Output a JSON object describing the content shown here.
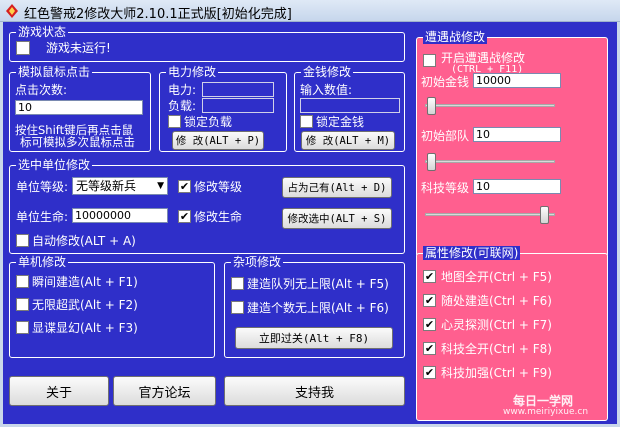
{
  "window": {
    "title": "红色警戒2修改大师2.10.1正式版[初始化完成]"
  },
  "game_status": {
    "title": "游戏状态",
    "status_text": "游戏未运行!"
  },
  "mouse": {
    "title": "模拟鼠标点击",
    "clicks_label": "点击次数:",
    "clicks_value": "10",
    "hint_line1": "按住Shift键后再点击鼠",
    "hint_line2": "标可模拟多次鼠标点击"
  },
  "power": {
    "title": "电力修改",
    "power_label": "电力:",
    "load_label": "负载:",
    "lock_label": "锁定负载",
    "modify_button": "修 改(ALT + P)"
  },
  "money": {
    "title": "金钱修改",
    "input_label": "输入数值:",
    "lock_label": "锁定金钱",
    "modify_button": "修 改(ALT + M)"
  },
  "unit": {
    "title": "选中单位修改",
    "level_label": "单位等级:",
    "level_value": "无等级新兵",
    "modify_level_label": "修改等级",
    "owner_button": "占为己有(Alt + D)",
    "life_label": "单位生命:",
    "life_value": "10000000",
    "modify_life_label": "修改生命",
    "modify_selected_button": "修改选中(ALT + S)",
    "auto_label": "自动修改(ALT + A)"
  },
  "single": {
    "title": "单机修改",
    "items": [
      "瞬间建造(Alt + F1)",
      "无限超武(Alt + F2)",
      "显谍显幻(Alt + F3)"
    ]
  },
  "misc": {
    "title": "杂项修改",
    "items": [
      "建造队列无上限(Alt + F5)",
      "建造个数无上限(Alt + F6)"
    ],
    "pass_button": "立即过关(Alt + F8)"
  },
  "bottom": {
    "about_button": "关于",
    "forum_button": "官方论坛",
    "support_button": "支持我"
  },
  "encounter": {
    "title": "遭遇战修改",
    "enable_label": "开启遭遇战修改",
    "enable_hotkey": "(CTRL + F11)",
    "money_label": "初始金钱",
    "money_value": "10000",
    "money_slider": 0.02,
    "troops_label": "初始部队",
    "troops_value": "10",
    "troops_slider": 0.02,
    "tech_label": "科技等级",
    "tech_value": "10",
    "tech_slider": 0.95
  },
  "attributes": {
    "title": "属性修改(可联网)",
    "items": [
      "地图全开(Ctrl + F5)",
      "随处建造(Ctrl + F6)",
      "心灵探测(Ctrl + F7)",
      "科技全开(Ctrl + F8)",
      "科技加强(Ctrl + F9)"
    ],
    "checked": [
      "✔",
      "✔",
      "✔",
      "✔",
      "✔"
    ]
  },
  "watermark": {
    "line1": "每日一学网",
    "line2": "www.meiriyixue.cn"
  }
}
